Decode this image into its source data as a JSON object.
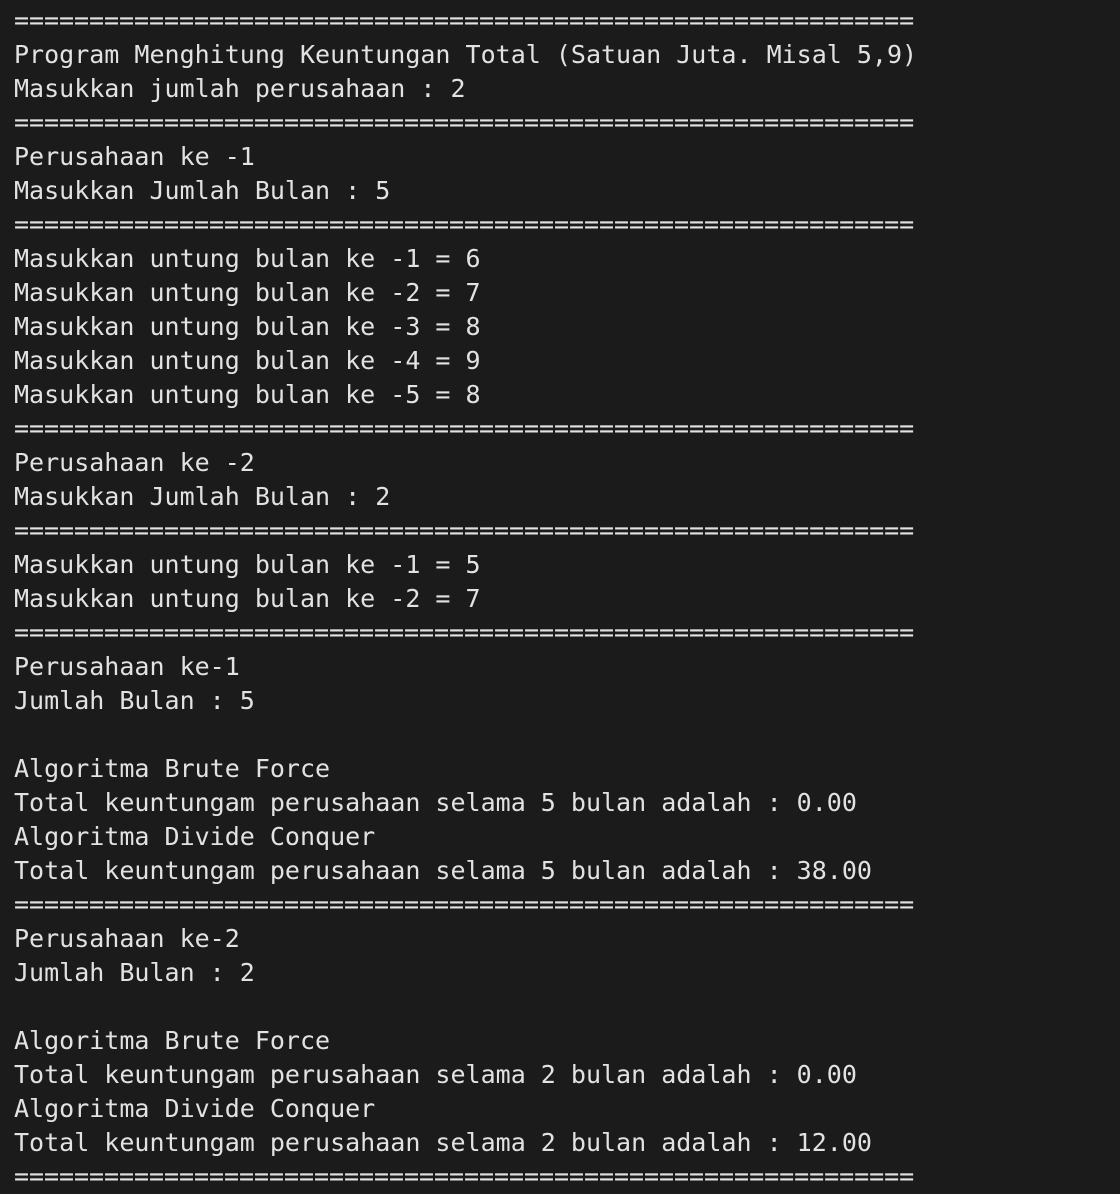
{
  "terminal": {
    "lines": [
      "============================================================",
      "Program Menghitung Keuntungan Total (Satuan Juta. Misal 5,9)",
      "Masukkan jumlah perusahaan : 2",
      "============================================================",
      "Perusahaan ke -1",
      "Masukkan Jumlah Bulan : 5",
      "============================================================",
      "Masukkan untung bulan ke -1 = 6",
      "Masukkan untung bulan ke -2 = 7",
      "Masukkan untung bulan ke -3 = 8",
      "Masukkan untung bulan ke -4 = 9",
      "Masukkan untung bulan ke -5 = 8",
      "============================================================",
      "Perusahaan ke -2",
      "Masukkan Jumlah Bulan : 2",
      "============================================================",
      "Masukkan untung bulan ke -1 = 5",
      "Masukkan untung bulan ke -2 = 7",
      "============================================================",
      "Perusahaan ke-1",
      "Jumlah Bulan : 5",
      "",
      "Algoritma Brute Force",
      "Total keuntungam perusahaan selama 5 bulan adalah : 0.00",
      "Algoritma Divide Conquer",
      "Total keuntungam perusahaan selama 5 bulan adalah : 38.00",
      "============================================================",
      "Perusahaan ke-2",
      "Jumlah Bulan : 2",
      "",
      "Algoritma Brute Force",
      "Total keuntungam perusahaan selama 2 bulan adalah : 0.00",
      "Algoritma Divide Conquer",
      "Total keuntungam perusahaan selama 2 bulan adalah : 12.00",
      "============================================================"
    ]
  },
  "colors": {
    "background": "#1b1b1b",
    "text": "#e2e2e2"
  }
}
